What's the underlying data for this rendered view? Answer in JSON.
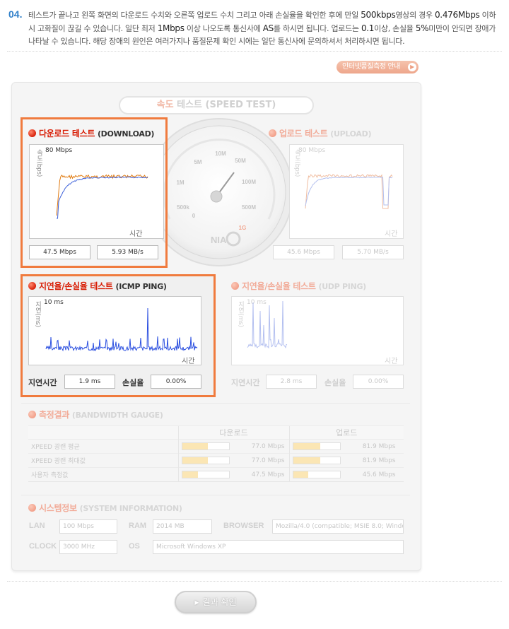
{
  "step": {
    "number": "04.",
    "text_parts": [
      "테스트가 끝나고 왼쪽 화면의 다운로드 수치와 오른쪽 업로드 수치 그리고 아래 손실율을 확인한 후에 만일 ",
      "500kbps",
      "영상의 경우 ",
      "0.476Mbps",
      " 이하 시 고화질이 끊길 수 있습니다. 일단 최저 ",
      "1Mbps",
      " 이상 나오도록 통신사에 ",
      "AS",
      "를 하시면 됩니다. 업로드는 ",
      "0.1",
      "이상, 손실율 ",
      "5%",
      "미만이 안되면 장애가 나타날 수 있습니다. 해당 장애의 원인은 여러가지나 품질문제 확인 시에는 일단 통신사에 문의하셔서 처리하시면 됩니다."
    ]
  },
  "guide_button": {
    "label": "인터넷품질측정 안내",
    "icon": "arrow-right-icon"
  },
  "speed_test": {
    "title_ko": "속도",
    "title_rest": " 테스트 (SPEED TEST)",
    "download": {
      "title_ko": "다운로드 테스트",
      "title_en": "(DOWNLOAD)",
      "ylabel": "속도(bps)",
      "scale": "80 Mbps",
      "xlabel": "시간",
      "mbps": "47.5 Mbps",
      "mbs": "5.93 MB/s"
    },
    "upload": {
      "title_ko": "업로드 테스트",
      "title_en": "(UPLOAD)",
      "ylabel": "속도(bps)",
      "scale": "80 Mbps",
      "xlabel": "시간",
      "mbps": "45.6 Mbps",
      "mbs": "5.70 MB/s"
    },
    "gauge": {
      "labels": [
        "0",
        "500k",
        "1M",
        "5M",
        "10M",
        "50M",
        "100M",
        "500M",
        "1G"
      ],
      "brand": "NIA"
    }
  },
  "ping": {
    "icmp": {
      "title_ko": "지연율/손실율 테스트",
      "title_en": "(ICMP PING)",
      "ylabel": "지연(ms)",
      "scale": "10 ms",
      "xlabel": "시간",
      "delay_label": "지연시간",
      "delay": "1.9 ms",
      "loss_label": "손실율",
      "loss": "0.00%"
    },
    "udp": {
      "title_ko": "지연율/손실율 테스트",
      "title_en": "(UDP PING)",
      "ylabel": "지연(ms)",
      "scale": "10 ms",
      "xlabel": "시간",
      "delay_label": "지연시간",
      "delay": "2.8 ms",
      "loss_label": "손실율",
      "loss": "0.00%"
    }
  },
  "bandwidth": {
    "title_ko": "측정결과",
    "title_en": "(BANDWIDTH GAUGE)",
    "headers": [
      "",
      "다운로드",
      "업로드"
    ],
    "rows": [
      {
        "label": "XPEED 광랜 평균",
        "down": "77.0 Mbps",
        "down_pct": 0.56,
        "up": "81.9 Mbps",
        "up_pct": 0.58
      },
      {
        "label": "XPEED 광랜 최대값",
        "down": "77.0 Mbps",
        "down_pct": 0.56,
        "up": "81.9 Mbps",
        "up_pct": 0.58
      },
      {
        "label": "사용자 측정값",
        "down": "47.5 Mbps",
        "down_pct": 0.34,
        "up": "45.6 Mbps",
        "up_pct": 0.33
      }
    ]
  },
  "system": {
    "title_ko": "시스템정보",
    "title_en": "(SYSTEM INFORMATION)",
    "lan_label": "LAN",
    "lan": "100 Mbps",
    "ram_label": "RAM",
    "ram": "2014 MB",
    "browser_label": "BROWSER",
    "browser": "Mozilla/4.0 (compatible; MSIE 8.0; Windo",
    "clock_label": "CLOCK",
    "clock": "3000 MHz",
    "os_label": "OS",
    "os": "Microsoft Windows XP"
  },
  "confirm_button": {
    "label": "결과 확인",
    "icon": "play-icon"
  },
  "colors": {
    "highlight": "#f07b3e",
    "accent_red": "#d81e06",
    "step_blue": "#2f7fc9",
    "line_orange": "#e07a10",
    "line_blue": "#3b5fd9"
  }
}
